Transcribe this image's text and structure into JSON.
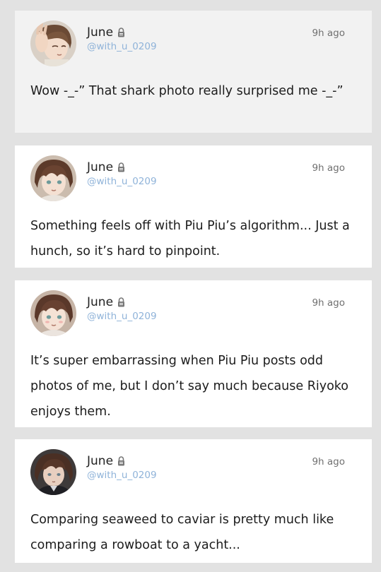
{
  "posts": [
    {
      "name": "June",
      "handle": "@with_u_0209",
      "time": "9h ago",
      "text": "Wow -_-” That shark photo really surprised me -_-”",
      "avatar_icon": "june-avatar-hand-icon"
    },
    {
      "name": "June",
      "handle": "@with_u_0209",
      "time": "9h ago",
      "text": "Something feels off with Piu Piu’s algorithm... Just a hunch, so it’s hard to pinpoint.",
      "avatar_icon": "june-avatar-icon"
    },
    {
      "name": "June",
      "handle": "@with_u_0209",
      "time": "9h ago",
      "text": "It’s super embarrassing when Piu Piu posts odd photos of me, but I don’t say much because Riyoko enjoys them.",
      "avatar_icon": "june-avatar-icon"
    },
    {
      "name": "June",
      "handle": "@with_u_0209",
      "time": "9h ago",
      "text": "Comparing seaweed to caviar is pretty much like comparing a rowboat to a yacht...",
      "avatar_icon": "june-avatar-dark-icon"
    }
  ],
  "colors": {
    "background": "#e2e2e2",
    "card": "#ffffff",
    "card_highlight": "#f2f2f2",
    "handle": "#8fb3d9",
    "time": "#707070",
    "text": "#1c1c1c"
  }
}
